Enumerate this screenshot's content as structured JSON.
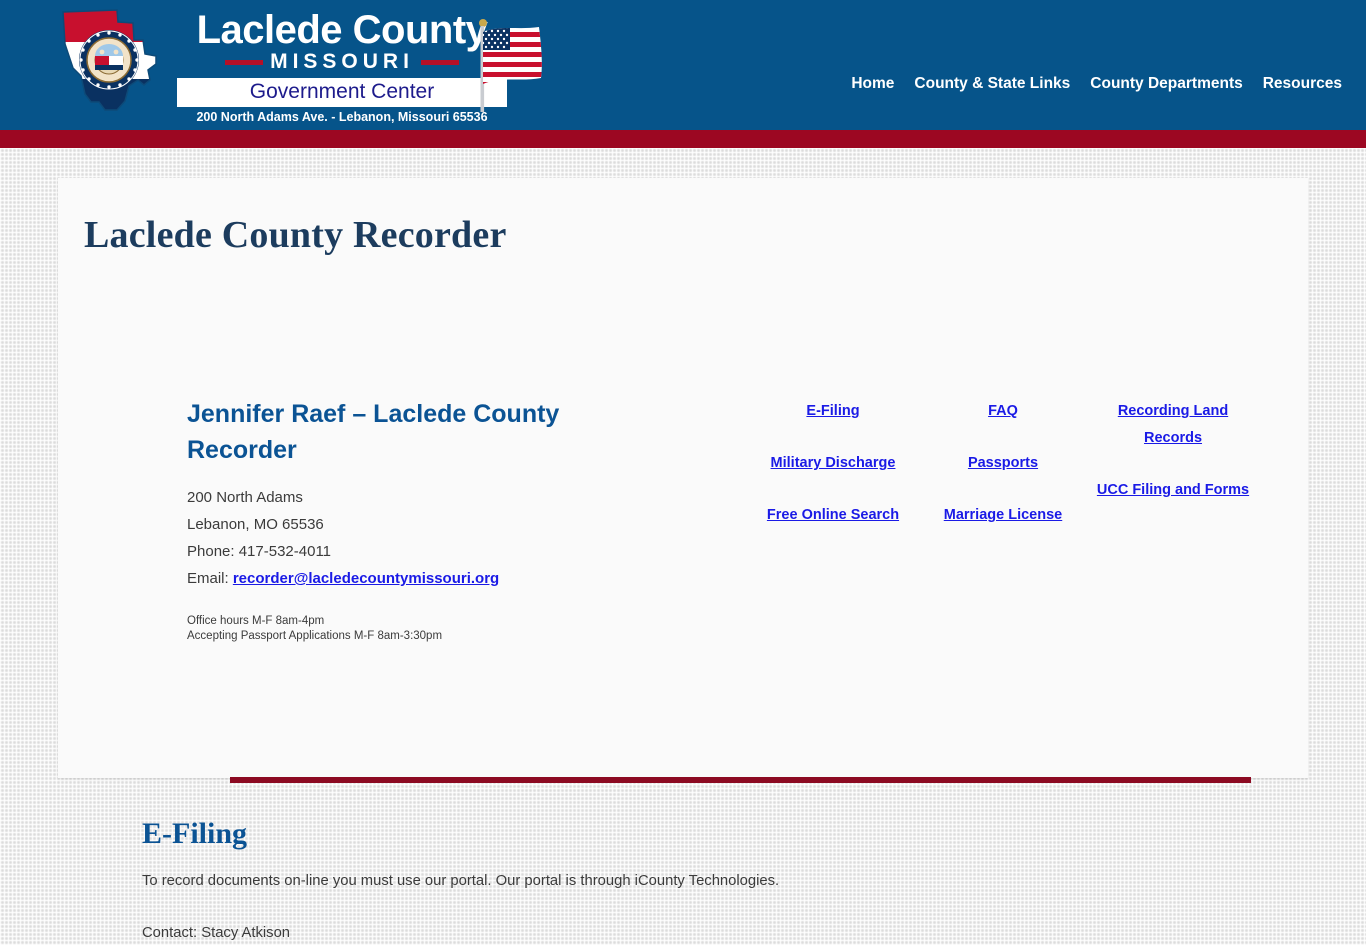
{
  "header": {
    "logo": {
      "county_name": "Laclede County",
      "state_name": "MISSOURI",
      "subtitle": "Government Center",
      "address": "200 North Adams Ave. - Lebanon, Missouri 65536",
      "state_shape_icon": "missouri-state-outline-icon",
      "seal_icon": "missouri-state-seal-icon",
      "flag_icon": "us-flag-icon"
    },
    "nav": [
      {
        "label": "Home"
      },
      {
        "label": "County & State Links"
      },
      {
        "label": "County Departments"
      },
      {
        "label": "Resources"
      }
    ]
  },
  "main": {
    "page_title": "Laclede County Recorder",
    "contact": {
      "officer_name": "Jennifer Raef – Laclede County Recorder",
      "address_line1": "200 North Adams",
      "address_line2": "Lebanon, MO 65536",
      "phone_label": "Phone: 417-532-4011",
      "email_label": "Email: ",
      "email_link": "recorder@lacledecountymissouri.org",
      "hours_line1": "Office hours M-F 8am-4pm",
      "hours_line2": "Accepting Passport Applications M-F 8am-3:30pm"
    },
    "link_columns": [
      {
        "links": [
          {
            "label": "E-Filing"
          },
          {
            "label": "Military Discharge"
          },
          {
            "label": "Free Online Search"
          }
        ]
      },
      {
        "links": [
          {
            "label": "FAQ"
          },
          {
            "label": "Passports"
          },
          {
            "label": "Marriage License"
          }
        ]
      },
      {
        "links": [
          {
            "label": "Recording Land Records"
          },
          {
            "label": "UCC Filing and Forms"
          }
        ]
      }
    ],
    "efiling": {
      "heading": "E-Filing",
      "paragraph": "To record documents on-line you must use our portal. Our portal is through iCounty Technologies.",
      "contact": "Contact: Stacy Atkison"
    }
  },
  "colors": {
    "header_blue": "#06548a",
    "stripe_red": "#9c0722",
    "divider_maroon": "#8c0a22",
    "link_blue": "#1a1ae6",
    "heading_blue": "#0b5394",
    "title_navy": "#1c3c5e"
  }
}
